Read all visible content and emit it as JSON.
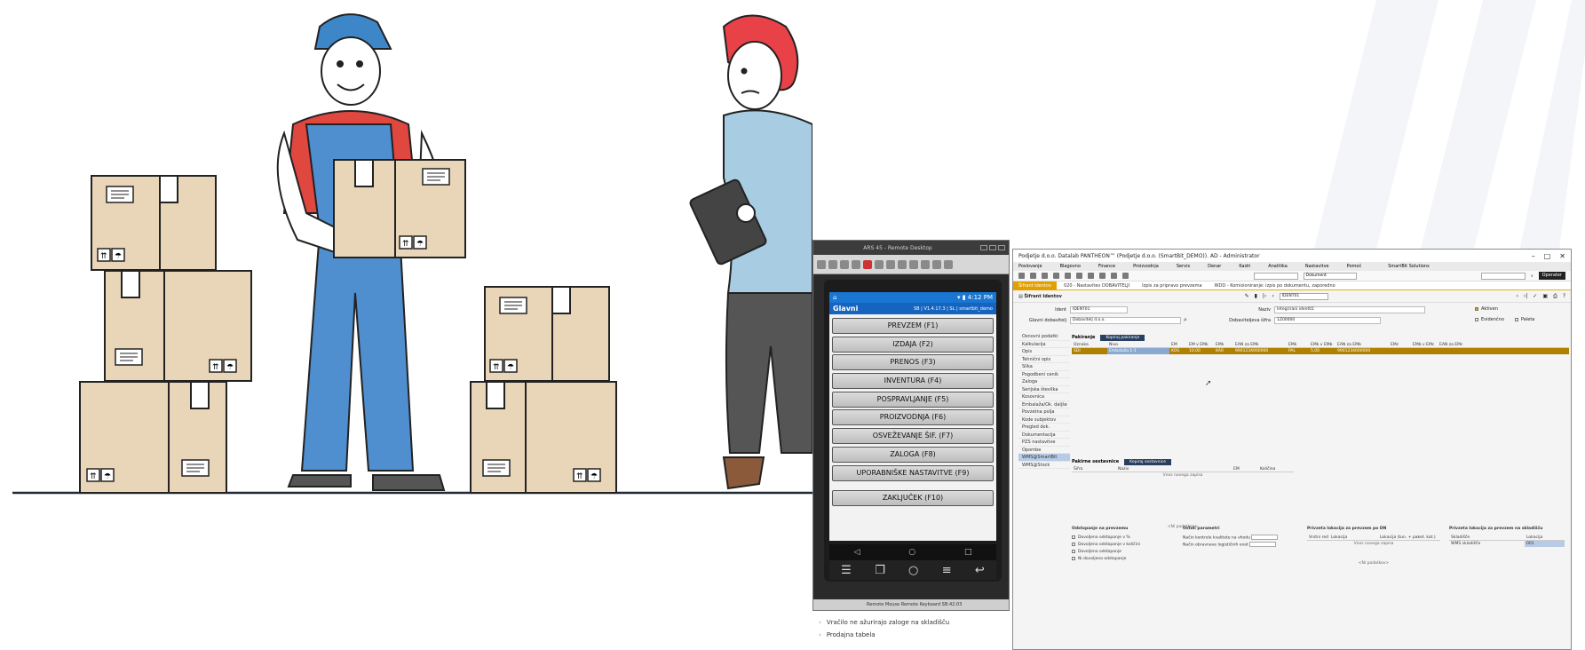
{
  "phone_window": {
    "title": "ARS 45 - Remote Desktop",
    "status_time": "4:12 PM",
    "header_title": "Glavni",
    "header_sub": "SB | V1.4.17.3 | SL | smartbit_demo",
    "menu": [
      "PREVZEM (F1)",
      "IZDAJA (F2)",
      "PRENOS (F3)",
      "INVENTURA (F4)",
      "POSPRAVLJANJE (F5)",
      "PROIZVODNJA (F6)",
      "OSVEŽEVANJE ŠIF. (F7)",
      "ZALOGA (F8)",
      "UPORABNIŠKE NASTAVITVE (F9)"
    ],
    "close_button": "ZAKLJUČEK (F10)",
    "nav_back": "◁",
    "nav_home": "○",
    "nav_recent": "□",
    "bottom_text": "Remote Mouse  Remote Keyboard  SB:42:03"
  },
  "below_links": [
    "Vračilo ne ažurirajo zaloge na skladišču",
    "Prodajna tabela"
  ],
  "pantheon": {
    "title": "Podjetje d.o.o.  Datalab PANTHEON™  (Podjetje d.o.o. (SmartBit_DEMO)). AD - Administrator",
    "menus": [
      "Poslovanje",
      "Blagovno",
      "Finance",
      "Proizvodnja",
      "Servis",
      "Denar",
      "Kadri",
      "Analitika",
      "Nastavitve",
      "Pomoč"
    ],
    "brand": "SmartBit Solutions",
    "doc_combo": "Dokument",
    "user_btn": "Operater",
    "tabs": [
      {
        "label": "Šifrant Identov",
        "active": true
      },
      {
        "label": "020 - Nastavitev DOBAVITELJI",
        "active": false
      },
      {
        "label": "Izpis za pripravo prevzema",
        "active": false
      },
      {
        "label": "WDD - Komisioniranje: izpis po dokumentu, zaporedno",
        "active": false
      }
    ],
    "form_title": "Šifrant Identov",
    "ident_code": "IDENT01",
    "fields": {
      "ident_label": "Ident",
      "ident_value": "IDENT01",
      "naziv_label": "Naziv",
      "naziv_value": "Integrirani ident01",
      "dobavitelj_label": "Glavni dobavitelj",
      "dobavitelj_value": "Dobavitelj d.o.o.",
      "sifra_label": "Dobaviteljeva šifra",
      "sifra_value": "1Z00000",
      "aktiven": "Aktiven",
      "evidencno": "Evidenčno",
      "paleta": "Paleta"
    },
    "left_menu": [
      "Osnovni podatki",
      "Kalkulacija",
      "Opis",
      "Tehnični opis",
      "Slika",
      "Pogodbeni cenik",
      "Zaloga",
      "Serijska številka",
      "Kosovnica",
      "Embalaža/Ok. daljše",
      "Povzetna polja",
      "Kode subjektov",
      "Pregled dok.",
      "Dokumentacija",
      "PZS nastavitve",
      "Opombe",
      "WMS@SmartBit",
      "WMS@Stock"
    ],
    "left_selected": "WMS@SmartBit",
    "packing": {
      "title": "Pakiranje",
      "copy_btn": "Kopiraj pakiranje",
      "columns": [
        "Oznaka",
        "Nivo",
        "EM",
        "EM v EMk",
        "EMk",
        "EAN za EMk",
        "EMk",
        "EMk v EMb",
        "EAN za EMb",
        "EMc",
        "EMb v EMc",
        "EAN za EMc"
      ],
      "row": [
        "SDI",
        "Embalaža 1-1",
        "KOS",
        "10,00",
        "KAR",
        "9901234000000",
        "PAL",
        "5,00",
        "9901234000000"
      ]
    },
    "components": {
      "title": "Pakirne sestavnice",
      "copy_btn": "Kopiraj sestavnice",
      "columns": [
        "Šifra",
        "Naziv",
        "EM",
        "Količina"
      ],
      "empty_hint": "Vnos novega zapisa",
      "no_data": "<Ni podatkov>"
    },
    "bottom": {
      "dev_title": "Odstopanje na prevzemu",
      "dev_options": [
        "Dovoljeno odstopanje v %",
        "Dovoljeno odstopanje v količini",
        "Dovoljeno odstopanje",
        "Ni dovoljeno odstopanje"
      ],
      "other_title": "Ostali parametri",
      "other_rows": [
        "Način kontrole kvalitete na vhodu",
        "Način obravnave logističnih enot"
      ],
      "dn_title": "Privzeta lokacija za prevzem po DN",
      "dn_cols": [
        "Vrstni red",
        "Lokacija",
        "Lokacija (tun. + paket. kat.)"
      ],
      "dn_hint": "Vnos novega zapisa",
      "dn_no_data": "<Ni podatkov>",
      "wh_title": "Privzeta lokacija za prevzem na skladišču",
      "wh_cols": [
        "Skladišče",
        "Lokacija"
      ],
      "wh_row": [
        "WMS skladišče",
        "001"
      ]
    }
  }
}
